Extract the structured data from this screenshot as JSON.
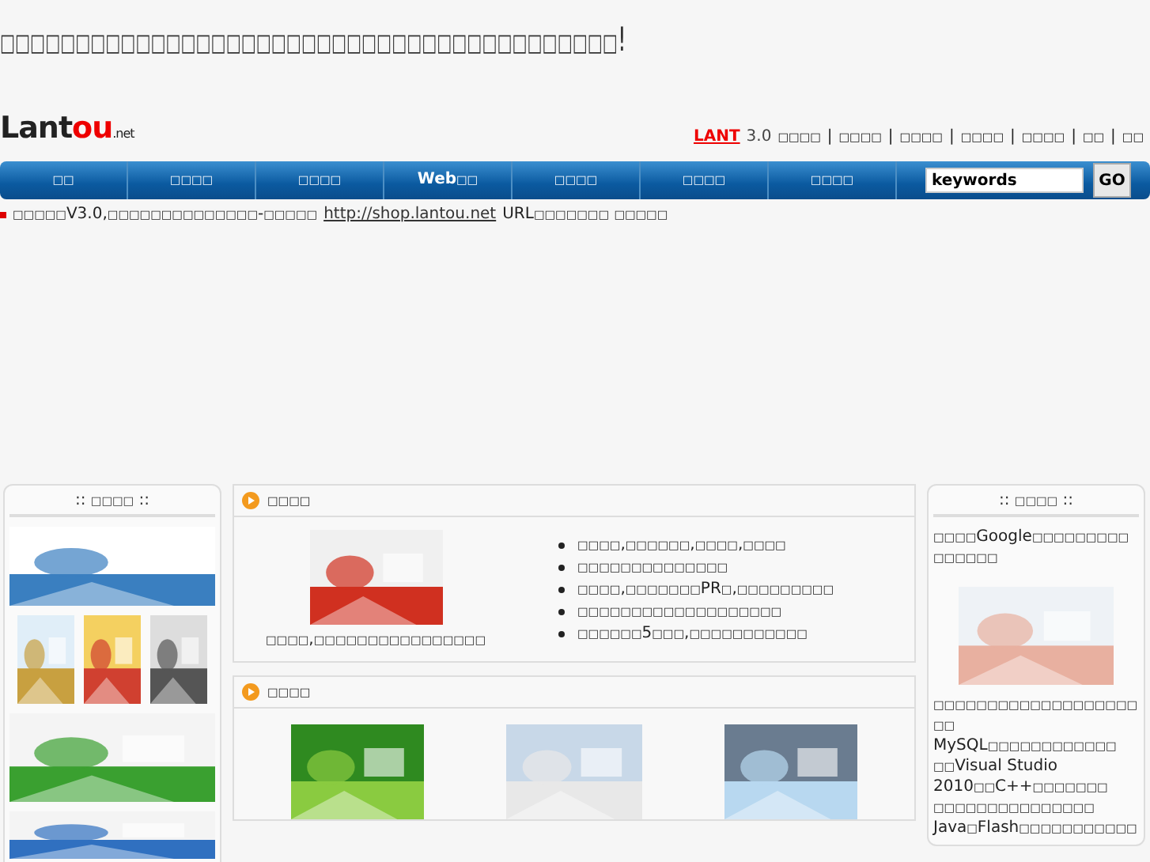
{
  "headline": "□□□□□□□□□□□□□□□□□□□□□□□□□□□□□□□□□□□□□□□□□!",
  "logo": {
    "main": "Lant",
    "accent": "ou",
    "suffix": ".net"
  },
  "top_links": {
    "brand": "LANT",
    "version": "3.0",
    "links": [
      "□□□□",
      "□□□□",
      "□□□□",
      "□□□□",
      "□□□□",
      "□□",
      "□□"
    ],
    "separator": "|"
  },
  "nav": {
    "items": [
      "□□",
      "□□□□",
      "□□□□",
      "Web□□",
      "□□□□",
      "□□□□",
      "□□□□"
    ],
    "search_value": "keywords",
    "go": "GO"
  },
  "notice": {
    "text": "□□□□□V3.0,□□□□□□□□□□□□□□-□□□□□",
    "link": "http://shop.lantou.net",
    "tail": "URL□□□□□□□ □□□□□"
  },
  "left_sidebar": {
    "title": ":: □□□□ ::"
  },
  "panels": [
    {
      "title": "□□□□",
      "caption": "□□□□,□□□□□□□□□□□□□□□□",
      "bullets": [
        "□□□□,□□□□□□,□□□□,□□□□",
        "□□□□□□□□□□□□□□",
        "□□□□,□□□□□□□PR□,□□□□□□□□□",
        "□□□□□□□□□□□□□□□□□□□",
        "□□□□□□5□□□,□□□□□□□□□□□"
      ]
    },
    {
      "title": "□□□□"
    }
  ],
  "right_sidebar": {
    "title": ":: □□□□ ::",
    "intro": "□□□□Google□□□□□□□□□□□□□□□",
    "body": "□□□□□□□□□□□□□□□□□□□□□ MySQL□□□□□□□□□□□□ □□Visual Studio 2010□□C++□□□□□□□ □□□□□□□□□□□□□□□ Java□Flash□□□□□□□□□□□"
  }
}
